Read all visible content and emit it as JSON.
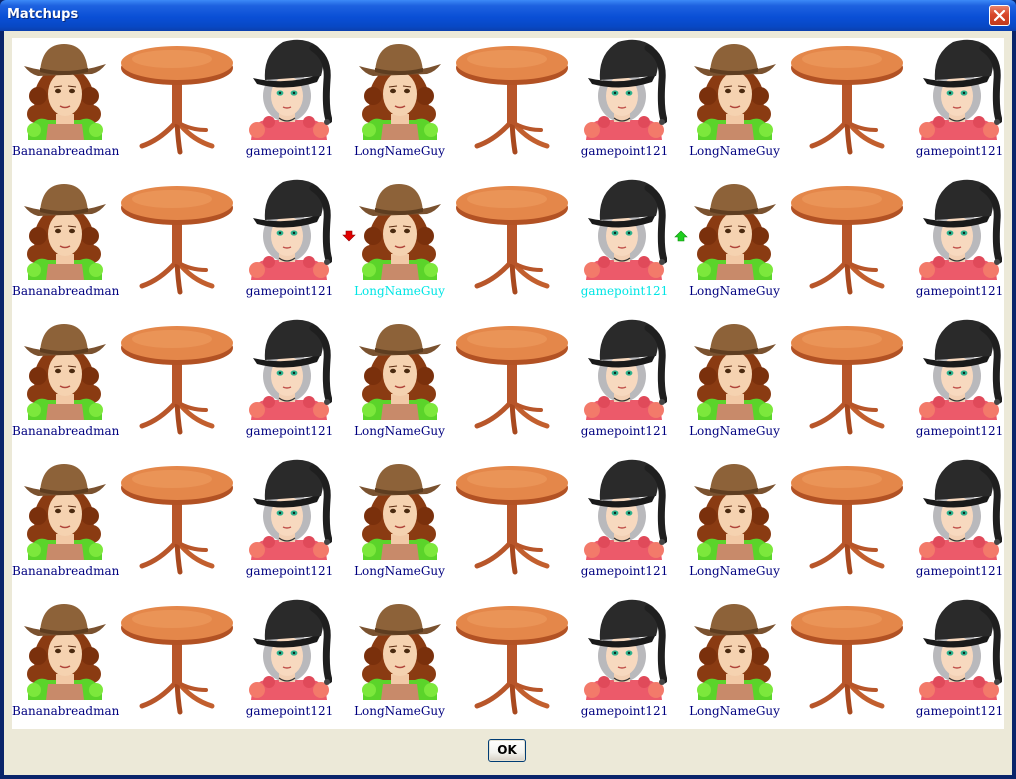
{
  "window": {
    "title": "Matchups"
  },
  "buttons": {
    "ok_label": "OK"
  },
  "icons": {
    "close": "close-icon",
    "move_down": "red-down-arrow-icon",
    "move_up": "green-up-arrow-icon"
  },
  "colors": {
    "name_text": "#000080",
    "highlight_text": "#00e5e5",
    "table": "#d9793f",
    "title_bar": "#0a4fd6"
  },
  "rows": [
    {
      "matches": [
        {
          "left": "Bananabreadman",
          "right": "gamepoint121"
        },
        {
          "left": "LongNameGuy",
          "right": "gamepoint121"
        },
        {
          "left": "LongNameGuy",
          "right": "gamepoint121"
        }
      ]
    },
    {
      "matches": [
        {
          "left": "Bananabreadman",
          "right": "gamepoint121"
        },
        {
          "left": "LongNameGuy",
          "right": "gamepoint121",
          "highlighted": true
        },
        {
          "left": "LongNameGuy",
          "right": "gamepoint121"
        }
      ]
    },
    {
      "matches": [
        {
          "left": "Bananabreadman",
          "right": "gamepoint121"
        },
        {
          "left": "LongNameGuy",
          "right": "gamepoint121"
        },
        {
          "left": "LongNameGuy",
          "right": "gamepoint121"
        }
      ]
    },
    {
      "matches": [
        {
          "left": "Bananabreadman",
          "right": "gamepoint121"
        },
        {
          "left": "LongNameGuy",
          "right": "gamepoint121"
        },
        {
          "left": "LongNameGuy",
          "right": "gamepoint121"
        }
      ]
    },
    {
      "matches": [
        {
          "left": "Bananabreadman",
          "right": "gamepoint121"
        },
        {
          "left": "LongNameGuy",
          "right": "gamepoint121"
        },
        {
          "left": "LongNameGuy",
          "right": "gamepoint121"
        }
      ]
    }
  ]
}
